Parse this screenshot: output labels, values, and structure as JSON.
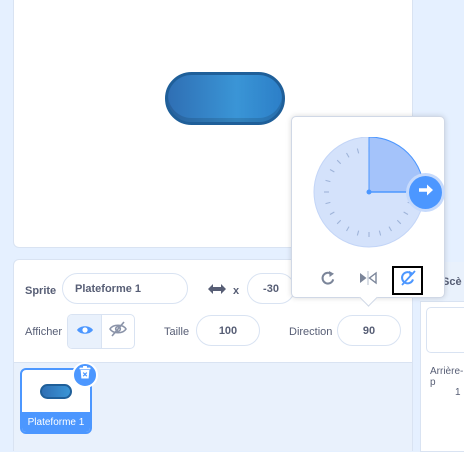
{
  "colors": {
    "accent": "#4c97ff",
    "text": "#575e75",
    "panel_bg": "#e9f1fc",
    "border": "#d9e3f2",
    "sprite_fill": "#3a95d6",
    "sprite_border": "#1f5f99"
  },
  "sprite_info": {
    "sprite_label": "Sprite",
    "sprite_name": "Plateforme 1",
    "x_label": "x",
    "x_value": "-30",
    "show_label": "Afficher",
    "size_label": "Taille",
    "size_value": "100",
    "direction_label": "Direction",
    "direction_value": "90"
  },
  "sprite_list": {
    "items": [
      {
        "name": "Plateforme 1",
        "selected": true
      }
    ]
  },
  "stage_panel": {
    "header_label": "Scè",
    "backdrops_label": "Arrière-p",
    "backdrops_count": "1"
  },
  "direction_popover": {
    "direction_degrees": 90,
    "rotation_styles": [
      "all-around-icon",
      "left-right-icon",
      "dont-rotate-icon"
    ],
    "selected_style": "dont-rotate-icon"
  }
}
